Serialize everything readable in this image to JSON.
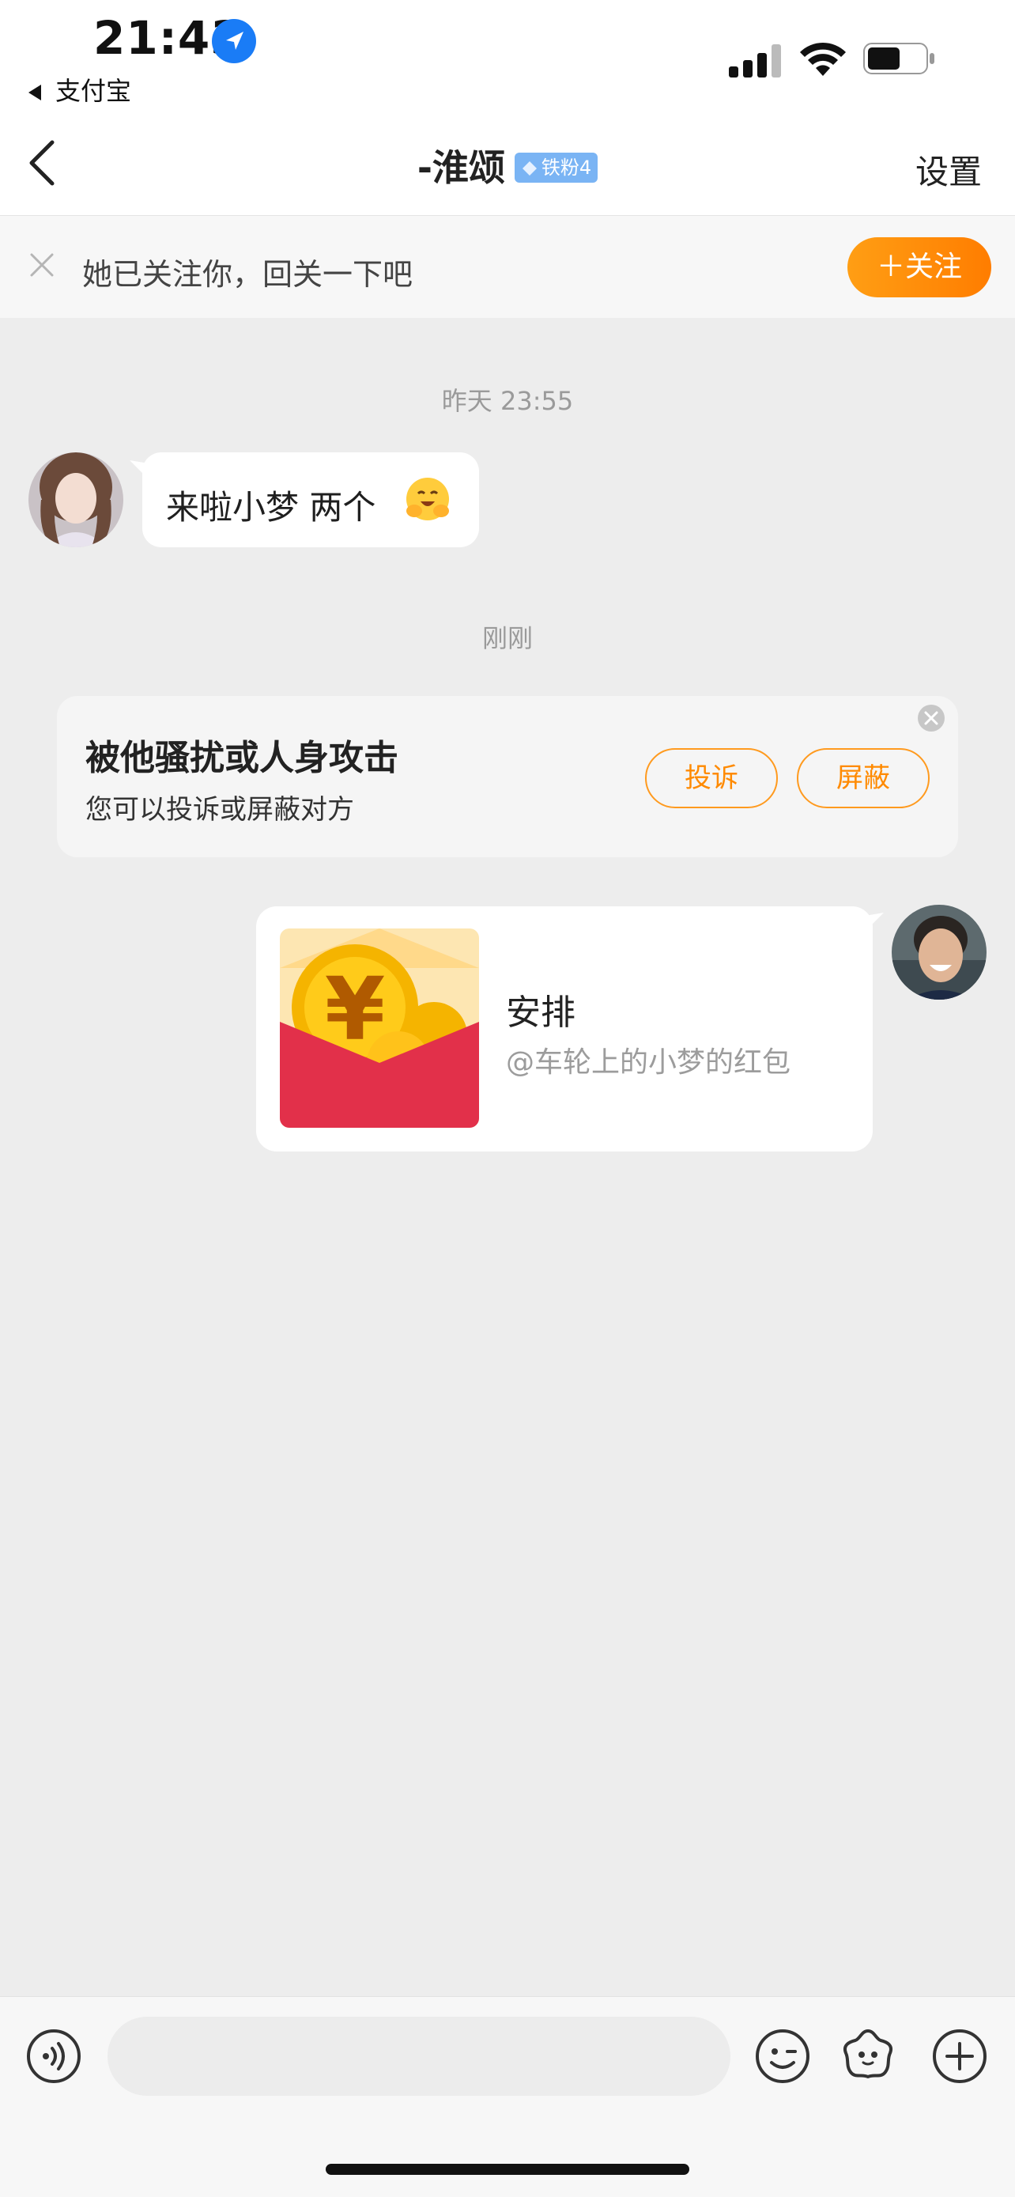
{
  "status_bar": {
    "time": "21:43",
    "back_app": "支付宝"
  },
  "nav": {
    "title": "-淮颂",
    "fan_badge": "铁粉4",
    "settings": "设置"
  },
  "follow_banner": {
    "text": "她已关注你，回关一下吧",
    "button": "＋关注"
  },
  "messages": [
    {
      "timestamp": "昨天 23:55"
    },
    {
      "from": "other",
      "text": "来啦小梦 两个"
    },
    {
      "timestamp": "刚刚"
    }
  ],
  "report_card": {
    "title": "被他骚扰或人身攻击",
    "subtitle": "您可以投诉或屏蔽对方",
    "complain_button": "投诉",
    "block_button": "屏蔽"
  },
  "red_packet": {
    "title": "安排",
    "subtitle": "@车轮上的小梦的红包"
  },
  "bottom_bar": {
    "icons": [
      "voice-icon",
      "emoji-icon",
      "sticker-icon",
      "plus-icon"
    ]
  },
  "colors": {
    "accent_orange": "#ff8a00",
    "packet_red": "#e2304a",
    "background": "#ededed"
  }
}
